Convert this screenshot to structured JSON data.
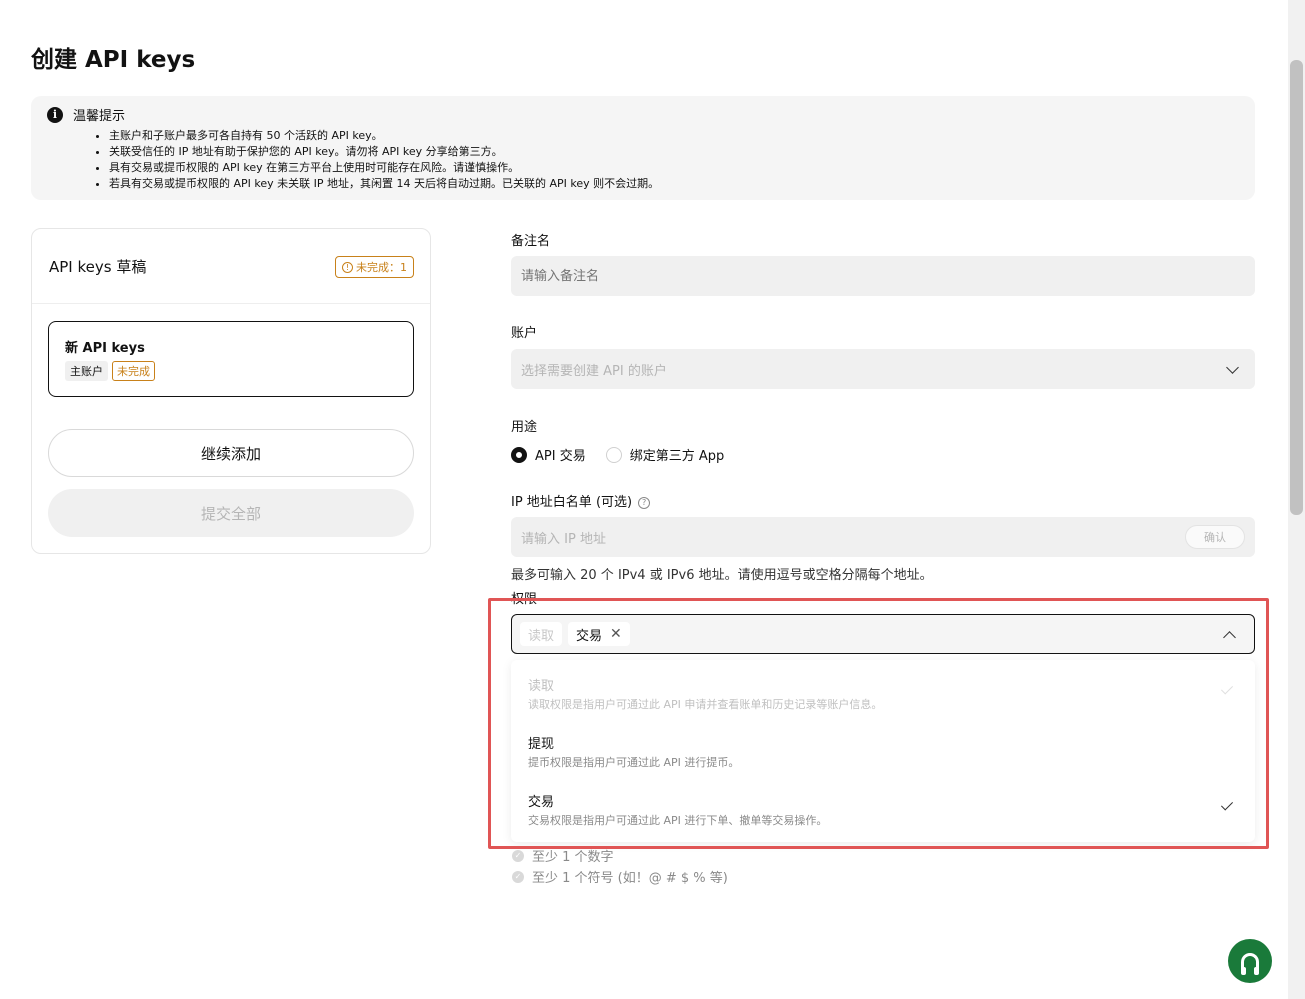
{
  "page": {
    "title": "创建 API keys"
  },
  "notice": {
    "title": "温馨提示",
    "items": [
      "主账户和子账户最多可各自持有 50 个活跃的 API key。",
      "关联受信任的 IP 地址有助于保护您的 API key。请勿将 API key 分享给第三方。",
      "具有交易或提币权限的 API key 在第三方平台上使用时可能存在风险。请谨慎操作。",
      "若具有交易或提币权限的 API key 未关联 IP 地址，其闲置 14 天后将自动过期。已关联的 API key 则不会过期。"
    ]
  },
  "drafts": {
    "title": "API keys 草稿",
    "incomplete_badge": "未完成：1",
    "card": {
      "title": "新 API keys",
      "tag_account": "主账户",
      "tag_status": "未完成"
    },
    "continue_label": "继续添加",
    "submit_label": "提交全部"
  },
  "form": {
    "remark": {
      "label": "备注名",
      "placeholder": "请输入备注名"
    },
    "account": {
      "label": "账户",
      "placeholder": "选择需要创建 API 的账户"
    },
    "usage": {
      "label": "用途",
      "option_api": "API 交易",
      "option_app": "绑定第三方 App"
    },
    "ip": {
      "label": "IP 地址白名单 (可选)",
      "placeholder": "请输入 IP 地址",
      "confirm": "确认",
      "hint": "最多可输入 20 个 IPv4 或 IPv6 地址。请使用逗号或空格分隔每个地址。"
    },
    "permissions": {
      "label": "权限",
      "chip_read": "读取",
      "chip_trade": "交易",
      "options": [
        {
          "title": "读取",
          "desc": "读取权限是指用户可通过此 API 申请并查看账单和历史记录等账户信息。"
        },
        {
          "title": "提现",
          "desc": "提币权限是指用户可通过此 API 进行提币。"
        },
        {
          "title": "交易",
          "desc": "交易权限是指用户可通过此 API 进行下单、撤单等交易操作。"
        }
      ]
    },
    "rules": [
      "至少 1 个数字",
      "至少 1 个符号 (如！@ # $ % 等)"
    ]
  },
  "colors": {
    "accent": "#121212",
    "warning": "#c8811a",
    "highlight": "#e05555",
    "support": "#1a7a3a"
  }
}
